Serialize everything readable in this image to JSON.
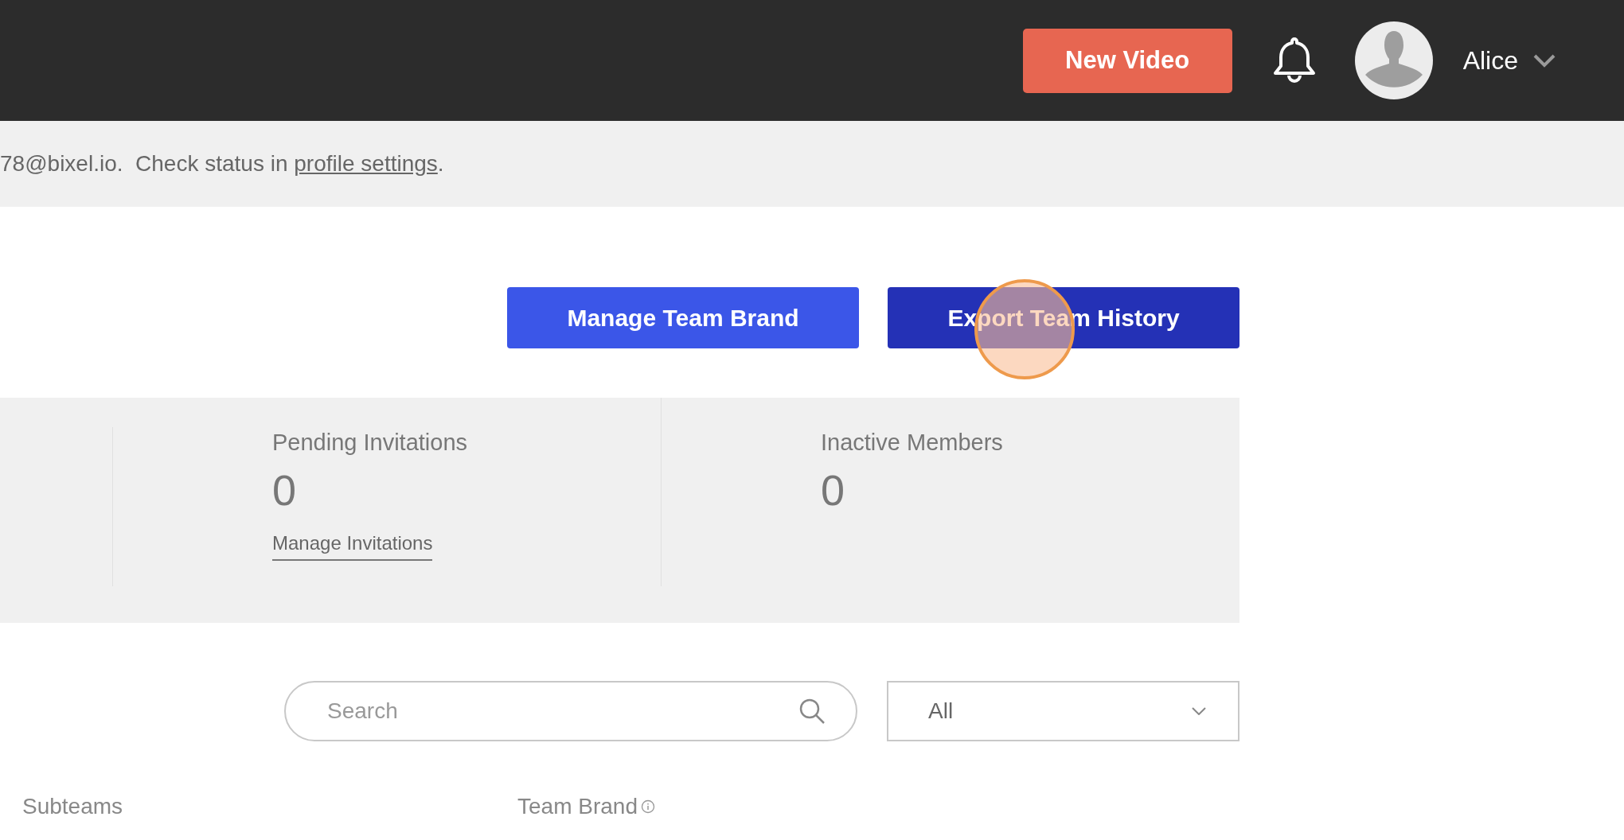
{
  "top_bar": {
    "new_video_button": "New Video",
    "user_name": "Alice"
  },
  "banner": {
    "text": "78@bixel.io.  Check status in ",
    "link": "profile settings",
    "after": "."
  },
  "actions": [
    {
      "label": "Manage Team Brand",
      "kind": "primary"
    },
    {
      "label": "Export Team History",
      "kind": "dark"
    }
  ],
  "stats": [
    {
      "label": "Pending Invitations",
      "value": "0",
      "link": "Manage Invitations"
    },
    {
      "label": "Inactive Members",
      "value": "0"
    }
  ],
  "search": {
    "placeholder": "Search"
  },
  "filter": {
    "value": "All"
  },
  "columns": [
    {
      "label": "Subteams",
      "info": false
    },
    {
      "label": "Team Brand",
      "info": true
    }
  ]
}
